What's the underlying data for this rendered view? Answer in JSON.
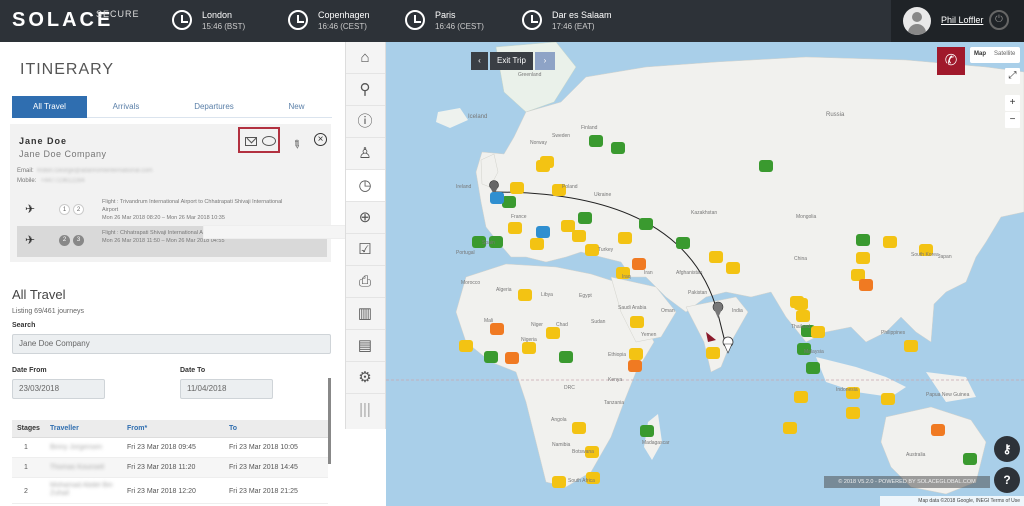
{
  "brand": {
    "name": "SOLACE",
    "tag": "SECURE"
  },
  "clocks": [
    {
      "city": "London",
      "time": "15:46 (BST)"
    },
    {
      "city": "Copenhagen",
      "time": "16:46 (CEST)"
    },
    {
      "city": "Paris",
      "time": "16:46 (CEST)"
    },
    {
      "city": "Dar es Salaam",
      "time": "17:46 (EAT)"
    }
  ],
  "user": {
    "name": "Phil Loffler"
  },
  "itinerary": {
    "title": "ITINERARY",
    "tabs": [
      "All Travel",
      "Arrivals",
      "Departures",
      "New"
    ],
    "active_tab": "All Travel"
  },
  "traveller": {
    "name": "Jane Doe",
    "company": "Jane Doe Company",
    "email_label": "Email:",
    "email": "Robin.George@adanromliinternational.com",
    "mobile_label": "Mobile:",
    "mobile": "+447723612284"
  },
  "flights": [
    {
      "stage_a": "1",
      "stage_b": "2",
      "line1": "Flight : Trivandrum International Airport to Chhatrapati Shivaji International Airport",
      "line2": "Mon 26 Mar 2018 08:20 – Mon 26 Mar 2018 10:35"
    },
    {
      "stage_a": "2",
      "stage_b": "3",
      "line1": "Flight : Chhatrapati Shivaji International Airport to London Heathrow Airport",
      "line2": "Mon 26 Mar 2018 11:50 – Mon 26 Mar 2018 04:55"
    }
  ],
  "all_travel": {
    "title": "All Travel",
    "listing": "Listing 69/461 journeys",
    "search_label": "Search",
    "search_value": "Jane Doe Company",
    "date_from_label": "Date From",
    "date_from": "23/03/2018",
    "date_to_label": "Date To",
    "date_to": "11/04/2018"
  },
  "table": {
    "headers": [
      "Stages",
      "Traveller",
      "From*",
      "To"
    ],
    "rows": [
      [
        "1",
        "Binny Jorgensen",
        "Fri 23 Mar 2018 09:45",
        "Fri 23 Mar 2018 10:05"
      ],
      [
        "1",
        "Thomas Kounsell",
        "Fri 23 Mar 2018 11:20",
        "Fri 23 Mar 2018 14:45"
      ],
      [
        "2",
        "Mohamad Abdel Bin Zuhail",
        "Fri 23 Mar 2018 12:20",
        "Fri 23 Mar 2018 21:25"
      ]
    ]
  },
  "tools": [
    "home-icon",
    "search-icon",
    "info-icon",
    "person-icon",
    "history-icon",
    "globe-icon",
    "checklist-icon",
    "print-icon",
    "bar-chart-icon",
    "newspaper-icon",
    "gear-icon",
    "handle-icon"
  ],
  "map": {
    "exit_label": "Exit Trip",
    "map_label": "Map",
    "satellite_label": "Satellite",
    "copyright": "© 2018 V5.2.0 - POWERED BY SOLACEGLOBAL.COM",
    "attribution": "Map data ©2018 Google, INEGI  Terms of Use",
    "labels": [
      "Iceland",
      "Ireland",
      "Portugal",
      "Morocco",
      "Algeria",
      "Libya",
      "Egypt",
      "Mali",
      "Niger",
      "Chad",
      "Sudan",
      "Nigeria",
      "Ethiopia",
      "Kenya",
      "DRC",
      "Angola",
      "Tanzania",
      "Namibia",
      "Botswana",
      "South Africa",
      "Madagascar",
      "Sweden",
      "Finland",
      "Norway",
      "Poland",
      "Ukraine",
      "France",
      "Spain",
      "Turkey",
      "Iraq",
      "Iran",
      "Saudi Arabia",
      "Oman",
      "Yemen",
      "Kazakhstan",
      "Mongolia",
      "China",
      "Afghanistan",
      "Pakistan",
      "India",
      "Thailand",
      "Malaysia",
      "Indonesia",
      "Papua New Guinea",
      "Australia",
      "Japan",
      "South Korea",
      "Philippines",
      "Russia",
      "Greenland"
    ]
  },
  "colors": {
    "primary": "#2f6eb0",
    "topbar": "#2d3238",
    "accent": "#a0192b",
    "green": "#3a9a2f",
    "yellow": "#f3c313",
    "orange": "#f07a22"
  }
}
